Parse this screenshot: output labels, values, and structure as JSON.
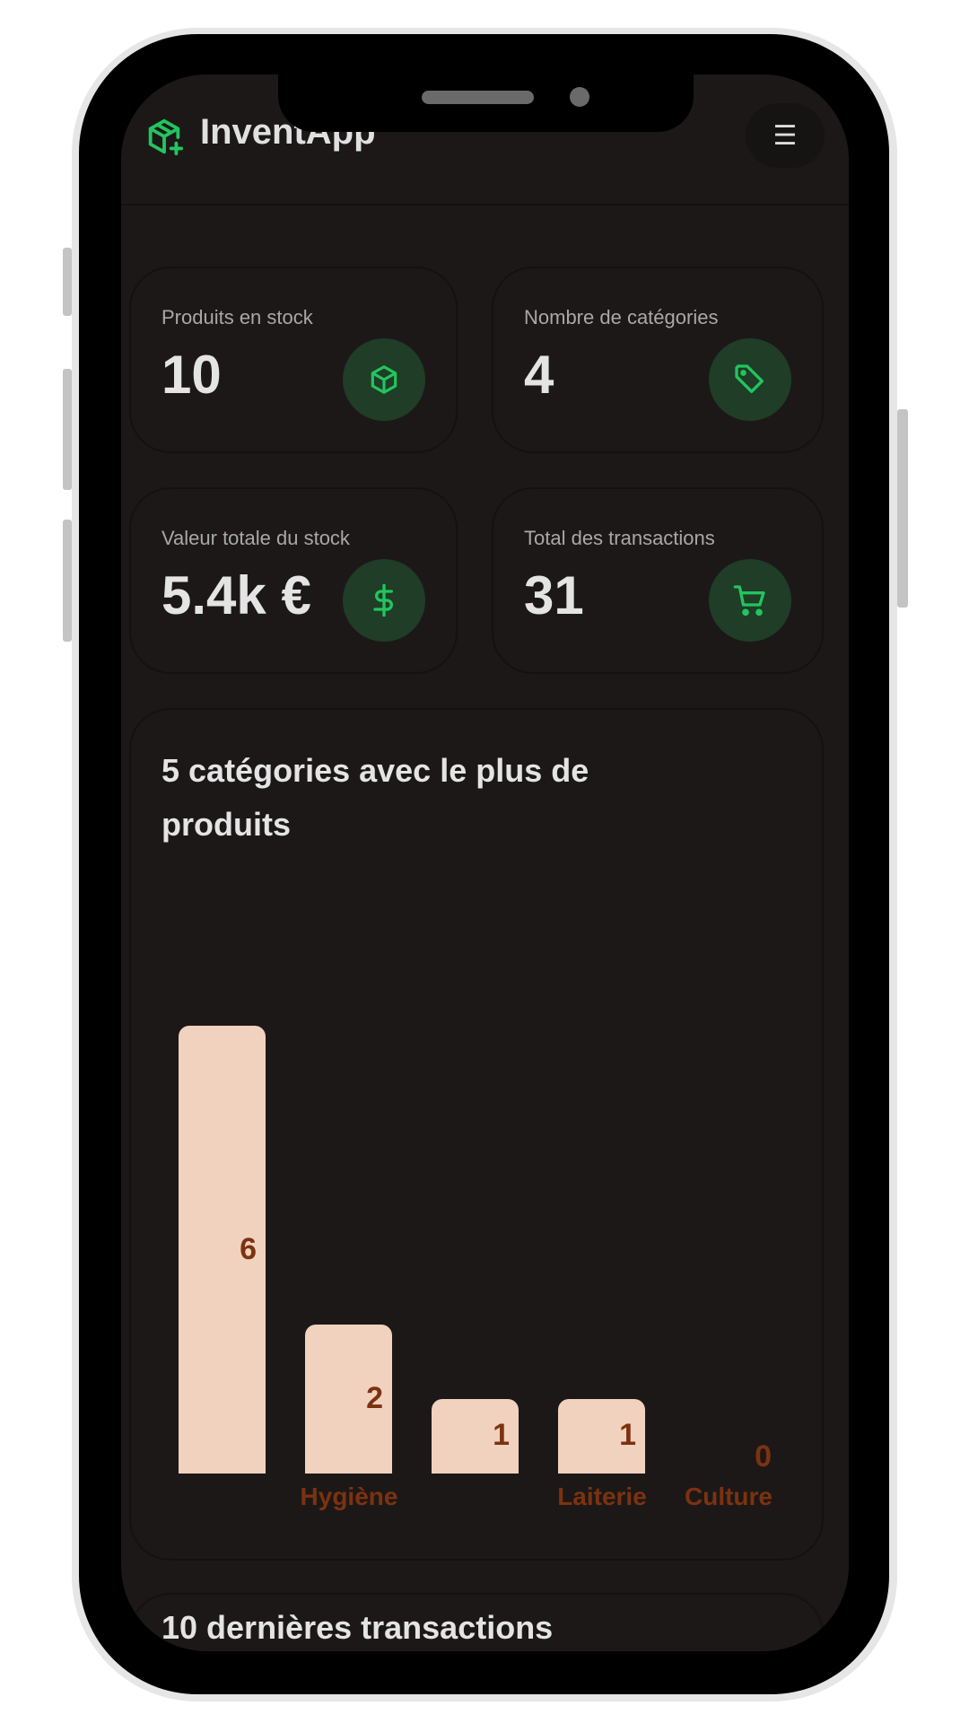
{
  "header": {
    "brand": "InventApp",
    "logo_icon": "package-plus-icon",
    "menu_icon": "hamburger-icon"
  },
  "stats": [
    {
      "label": "Produits en stock",
      "value": "10",
      "icon": "box-icon"
    },
    {
      "label": "Nombre de catégories",
      "value": "4",
      "icon": "tag-icon"
    },
    {
      "label": "Valeur totale du stock",
      "value": "5.4k €",
      "icon": "dollar-icon"
    },
    {
      "label": "Total des transactions",
      "value": "31",
      "icon": "cart-icon"
    }
  ],
  "chart_data": {
    "type": "bar",
    "title": "5 catégories avec le plus de produits",
    "categories": [
      "",
      "Hygiène",
      "",
      "Laiterie",
      "Culture"
    ],
    "values": [
      6,
      2,
      1,
      1,
      0
    ],
    "ylim": [
      0,
      6
    ],
    "value_labels": [
      "6",
      "2",
      "1",
      "1",
      "0"
    ],
    "colors": {
      "bar": "#f0d2bf",
      "label": "#7c3210"
    }
  },
  "transactions": {
    "title": "10 dernières transactions"
  },
  "colors": {
    "accent": "#22c55e",
    "icon_bg": "#1f3d27",
    "background": "#1c1818"
  }
}
